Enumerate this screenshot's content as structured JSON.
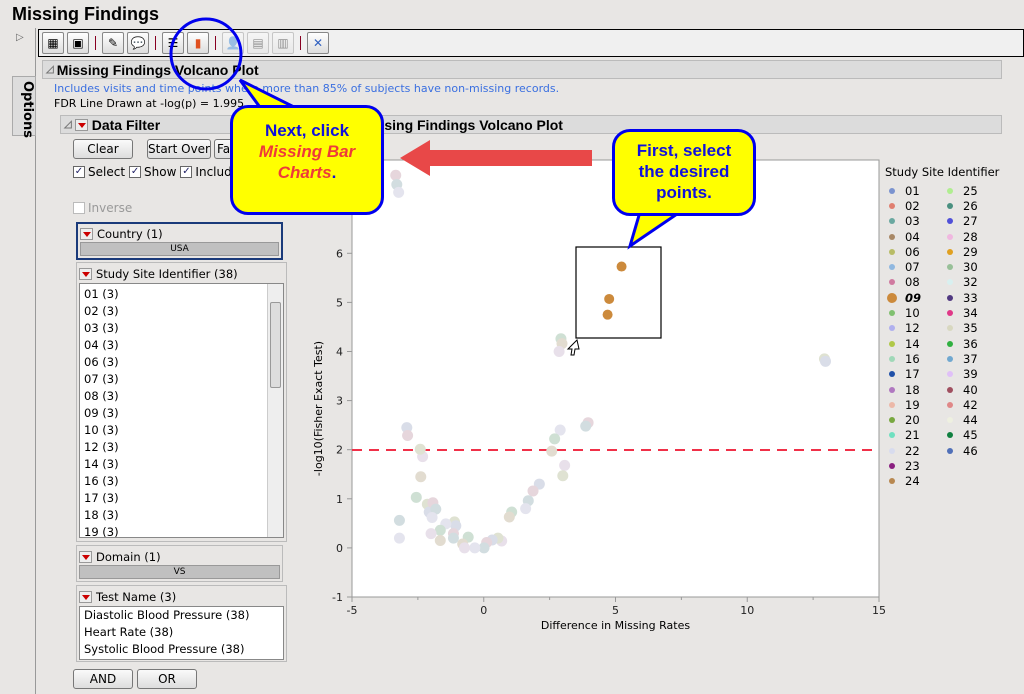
{
  "window_title": "Missing Findings",
  "options_tab": "Options",
  "toolbar": {
    "buttons": [
      {
        "icon": "table-search-icon",
        "enabled": true
      },
      {
        "icon": "subject-profile-icon",
        "enabled": true
      },
      {
        "icon": "comment-add-icon",
        "enabled": true
      },
      {
        "icon": "comment-view-icon",
        "enabled": true
      },
      {
        "icon": "data-table-icon",
        "enabled": true
      },
      {
        "icon": "missing-bar-charts-icon",
        "enabled": true
      },
      {
        "icon": "user-search-icon",
        "enabled": false
      },
      {
        "icon": "profile-table-icon",
        "enabled": false
      },
      {
        "icon": "table-view-icon",
        "enabled": false
      },
      {
        "icon": "close-x-icon",
        "enabled": true
      }
    ]
  },
  "report": {
    "title": "Missing Findings Volcano Plot",
    "note": "Includes visits and time points where more than 85% of subjects have non-missing records.",
    "fdr": "FDR Line Drawn at -log(p) = 1.995"
  },
  "filter": {
    "title": "Data Filter",
    "clear": "Clear",
    "start_over": "Start Over",
    "favorites": "Fa",
    "checks": [
      {
        "label": "Select",
        "checked": true
      },
      {
        "label": "Show",
        "checked": true
      },
      {
        "label": "Includ",
        "checked": true
      }
    ],
    "inverse": "Inverse",
    "country": {
      "title": "Country (1)",
      "value": "USA"
    },
    "site": {
      "title": "Study Site Identifier (38)",
      "items": [
        "01 (3)",
        "02 (3)",
        "03 (3)",
        "04 (3)",
        "06 (3)",
        "07 (3)",
        "08 (3)",
        "09 (3)",
        "10 (3)",
        "12 (3)",
        "14 (3)",
        "16 (3)",
        "17 (3)",
        "18 (3)",
        "19 (3)"
      ]
    },
    "domain": {
      "title": "Domain (1)",
      "value": "VS"
    },
    "test": {
      "title": "Test Name (3)",
      "items": [
        "Diastolic Blood Pressure (38)",
        "Heart Rate (38)",
        "Systolic Blood Pressure (38)"
      ]
    },
    "and": "AND",
    "or": "OR"
  },
  "plot_header": "Missing Findings Volcano Plot",
  "chart_data": {
    "type": "scatter",
    "xlabel": "Difference in Missing Rates",
    "ylabel": "-log10(Fisher Exact Test)",
    "xlim": [
      -5,
      15
    ],
    "ylim": [
      -1,
      7.9
    ],
    "xticks": [
      "-5",
      "0",
      "5",
      "10",
      "15"
    ],
    "yticks": [
      "-1",
      "0",
      "1",
      "2",
      "3",
      "4",
      "5",
      "6"
    ],
    "fdr_line_y": 1.995,
    "selected_color": "#cc8a3c",
    "points": [
      {
        "x": 5.23,
        "y": 5.73,
        "selected": true
      },
      {
        "x": 4.76,
        "y": 5.07,
        "selected": true
      },
      {
        "x": 4.7,
        "y": 4.75,
        "selected": true
      },
      {
        "x": -3.34,
        "y": 7.59
      },
      {
        "x": -3.3,
        "y": 7.4
      },
      {
        "x": -3.23,
        "y": 7.24
      },
      {
        "x": 2.93,
        "y": 4.26
      },
      {
        "x": 2.97,
        "y": 4.16
      },
      {
        "x": 2.86,
        "y": 4.0
      },
      {
        "x": 12.93,
        "y": 3.85
      },
      {
        "x": 12.97,
        "y": 3.8
      },
      {
        "x": 3.96,
        "y": 2.55
      },
      {
        "x": 3.87,
        "y": 2.48
      },
      {
        "x": 2.9,
        "y": 2.4
      },
      {
        "x": 2.69,
        "y": 2.22
      },
      {
        "x": 2.58,
        "y": 1.97
      },
      {
        "x": 3.07,
        "y": 1.68
      },
      {
        "x": 3.0,
        "y": 1.47
      },
      {
        "x": 2.11,
        "y": 1.3
      },
      {
        "x": 1.87,
        "y": 1.16
      },
      {
        "x": 1.69,
        "y": 0.96
      },
      {
        "x": 1.59,
        "y": 0.8
      },
      {
        "x": 1.06,
        "y": 0.73
      },
      {
        "x": 0.97,
        "y": 0.63
      },
      {
        "x": 0.68,
        "y": 0.14
      },
      {
        "x": 0.54,
        "y": 0.2
      },
      {
        "x": 0.32,
        "y": 0.16
      },
      {
        "x": 0.11,
        "y": 0.11
      },
      {
        "x": 0.01,
        "y": 0
      },
      {
        "x": -0.34,
        "y": 0
      },
      {
        "x": -0.59,
        "y": 0.22
      },
      {
        "x": -0.8,
        "y": 0.08
      },
      {
        "x": -0.73,
        "y": 0
      },
      {
        "x": -1.11,
        "y": 0.53
      },
      {
        "x": -1.06,
        "y": 0.45
      },
      {
        "x": -1.15,
        "y": 0.29
      },
      {
        "x": -1.15,
        "y": 0.2
      },
      {
        "x": -1.44,
        "y": 0.49
      },
      {
        "x": -1.65,
        "y": 0.36
      },
      {
        "x": -1.65,
        "y": 0.15
      },
      {
        "x": -2.0,
        "y": 0.29
      },
      {
        "x": -2.14,
        "y": 0.89
      },
      {
        "x": -2.07,
        "y": 0.73
      },
      {
        "x": -1.93,
        "y": 0.92
      },
      {
        "x": -1.82,
        "y": 0.79
      },
      {
        "x": -1.96,
        "y": 0.62
      },
      {
        "x": -2.56,
        "y": 1.03
      },
      {
        "x": -2.39,
        "y": 1.45
      },
      {
        "x": -2.32,
        "y": 1.86
      },
      {
        "x": -2.41,
        "y": 2.01
      },
      {
        "x": -2.92,
        "y": 2.45
      },
      {
        "x": -2.89,
        "y": 2.29
      },
      {
        "x": -3.2,
        "y": 0.56
      },
      {
        "x": -3.2,
        "y": 0.2
      }
    ],
    "legend": {
      "title": "Study Site Identifier",
      "items": [
        {
          "label": "01",
          "color": "#7b93cf"
        },
        {
          "label": "02",
          "color": "#e07f70"
        },
        {
          "label": "03",
          "color": "#6aa8a0"
        },
        {
          "label": "04",
          "color": "#a88866"
        },
        {
          "label": "06",
          "color": "#b8bc66"
        },
        {
          "label": "07",
          "color": "#90b8e0"
        },
        {
          "label": "08",
          "color": "#d07aa0"
        },
        {
          "label": "09",
          "color": "#cc8a3c",
          "bold": true
        },
        {
          "label": "10",
          "color": "#80c070"
        },
        {
          "label": "12",
          "color": "#b0b0ee"
        },
        {
          "label": "14",
          "color": "#b0c848"
        },
        {
          "label": "16",
          "color": "#a0d8b8"
        },
        {
          "label": "17",
          "color": "#2050a8"
        },
        {
          "label": "18",
          "color": "#b078c0"
        },
        {
          "label": "19",
          "color": "#ecb8a8"
        },
        {
          "label": "20",
          "color": "#78a840"
        },
        {
          "label": "21",
          "color": "#70e0c0"
        },
        {
          "label": "22",
          "color": "#d8dcee"
        },
        {
          "label": "23",
          "color": "#8a2080"
        },
        {
          "label": "24",
          "color": "#b88850"
        },
        {
          "label": "25",
          "color": "#b0ee90"
        },
        {
          "label": "26",
          "color": "#4a9080"
        },
        {
          "label": "27",
          "color": "#5050d8"
        },
        {
          "label": "28",
          "color": "#f0b8e0"
        },
        {
          "label": "29",
          "color": "#e0a020"
        },
        {
          "label": "30",
          "color": "#98c098"
        },
        {
          "label": "32",
          "color": "#d8f0f0"
        },
        {
          "label": "33",
          "color": "#503880"
        },
        {
          "label": "34",
          "color": "#e03888"
        },
        {
          "label": "35",
          "color": "#d8d8c0"
        },
        {
          "label": "36",
          "color": "#30b040"
        },
        {
          "label": "37",
          "color": "#70a8d0"
        },
        {
          "label": "39",
          "color": "#e0c0f8"
        },
        {
          "label": "40",
          "color": "#a05060"
        },
        {
          "label": "42",
          "color": "#e08888"
        },
        {
          "label": "44",
          "color": "#eef0e0"
        },
        {
          "label": "45",
          "color": "#108040"
        },
        {
          "label": "46",
          "color": "#5070b8"
        }
      ]
    }
  },
  "annotations": {
    "callout_next": {
      "line1": "Next, click",
      "em": "Missing Bar Charts",
      "end": "."
    },
    "callout_first": "First, select the desired points.",
    "colors": {
      "callout_fill": "#ffff00",
      "callout_border": "#0000ee",
      "arrow": "#e84848"
    }
  }
}
